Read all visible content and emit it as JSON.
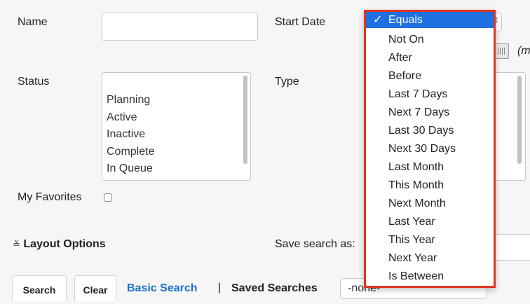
{
  "form": {
    "name_label": "Name",
    "start_date_label": "Start Date",
    "status_label": "Status",
    "type_label": "Type",
    "my_favorites_label": "My Favorites",
    "status_options": [
      "Planning",
      "Active",
      "Inactive",
      "Complete",
      "In Queue"
    ],
    "date_format_hint": "(m"
  },
  "layout_options": {
    "icon": "double-chevron-down-icon",
    "label": "Layout Options",
    "save_search_label": "Save search as:"
  },
  "footer": {
    "search_tab": "Search",
    "clear_tab": "Clear",
    "basic_search_link": "Basic Search",
    "separator": "|",
    "saved_searches_label": "Saved Searches",
    "saved_searches_value": "-none-"
  },
  "start_date_dropdown": {
    "selected": "Equals",
    "check_glyph": "✓",
    "options": [
      "Equals",
      "Not On",
      "After",
      "Before",
      "Last 7 Days",
      "Next 7 Days",
      "Last 30 Days",
      "Next 30 Days",
      "Last Month",
      "This Month",
      "Next Month",
      "Last Year",
      "This Year",
      "Next Year",
      "Is Between"
    ],
    "highlight_color": "#1e70e0",
    "border_color": "#e0341f"
  }
}
